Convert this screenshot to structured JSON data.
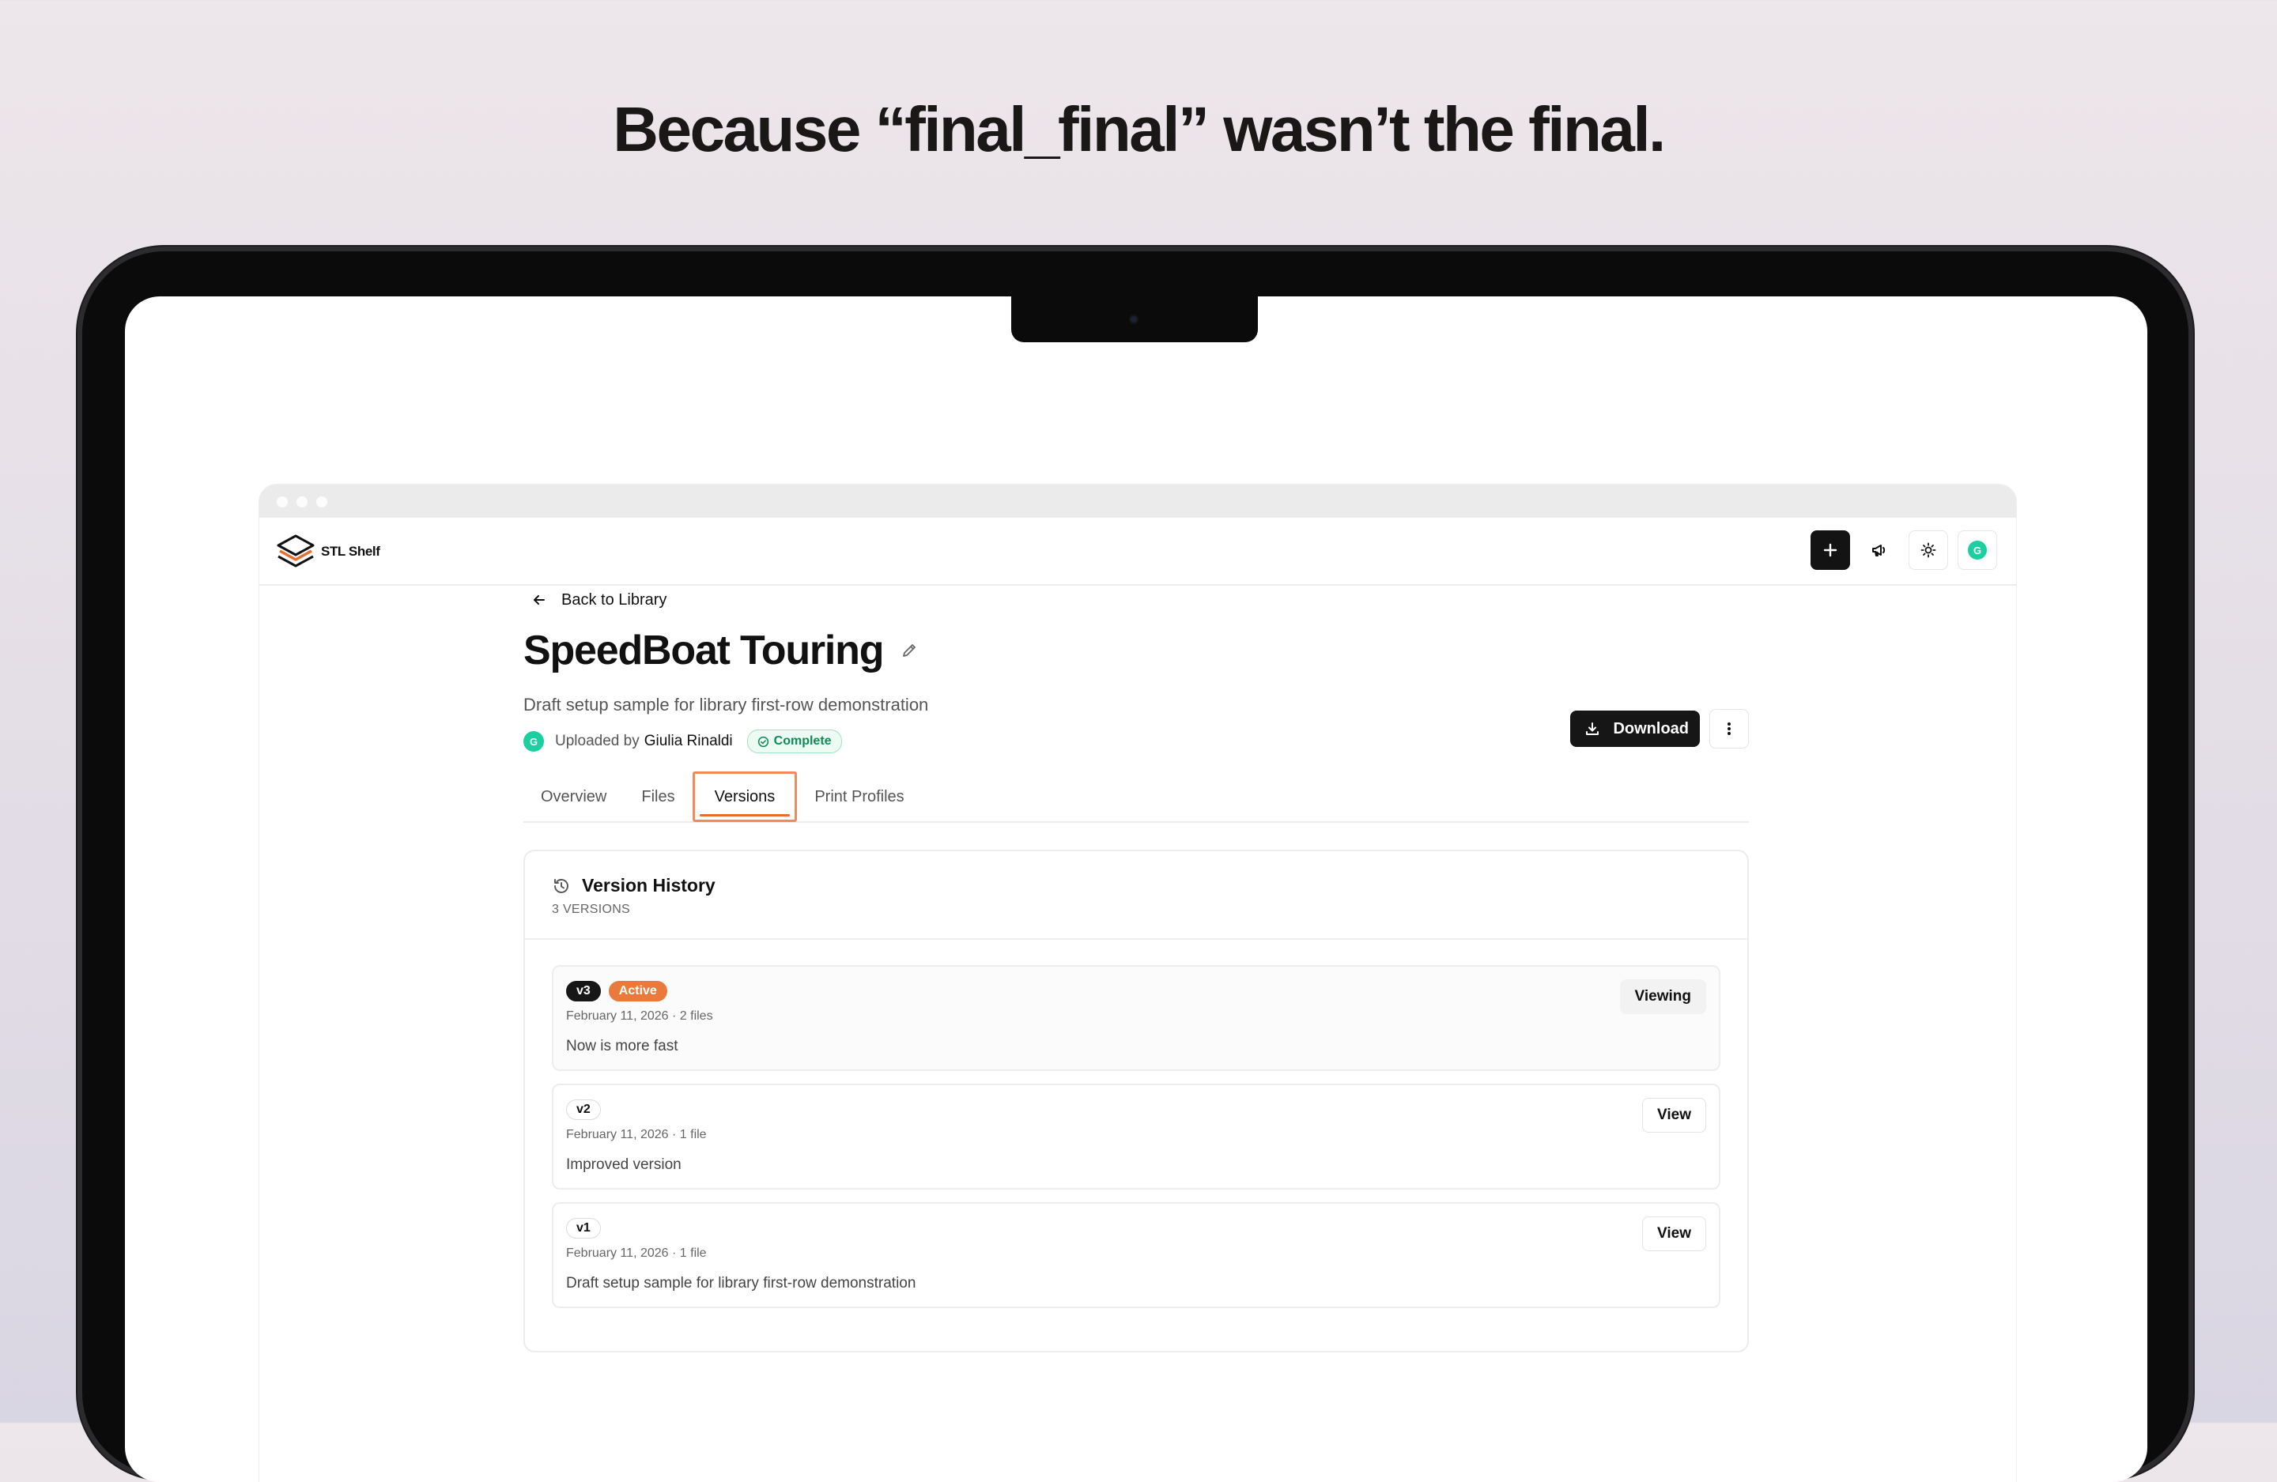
{
  "headline": "Because “final_final” wasn’t the final.",
  "app": {
    "name": "STL Shelf",
    "user_initial": "G"
  },
  "topbar": {
    "add_icon": "plus-icon",
    "announce_icon": "megaphone-icon",
    "theme_icon": "sun-icon"
  },
  "back_link": "Back to Library",
  "model": {
    "title": "SpeedBoat Touring",
    "description": "Draft setup sample for library first-row demonstration",
    "uploaded_prefix": "Uploaded by",
    "uploader": "Giulia Rinaldi",
    "uploader_initial": "G",
    "status": "Complete"
  },
  "actions": {
    "download": "Download"
  },
  "tabs": [
    {
      "label": "Overview"
    },
    {
      "label": "Files"
    },
    {
      "label": "Versions"
    },
    {
      "label": "Print Profiles"
    }
  ],
  "history": {
    "title": "Version History",
    "count": "3 VERSIONS",
    "versions": [
      {
        "tag": "v3",
        "active_label": "Active",
        "meta": "February 11, 2026 · 2 files",
        "note": "Now is more fast",
        "button": "Viewing"
      },
      {
        "tag": "v2",
        "meta": "February 11, 2026 · 1 file",
        "note": "Improved version",
        "button": "View"
      },
      {
        "tag": "v1",
        "meta": "February 11, 2026 · 1 file",
        "note": "Draft setup sample for library first-row demonstration",
        "button": "View"
      }
    ]
  },
  "colors": {
    "accent": "#ea7a3b",
    "success": "#0f8c55",
    "avatar": "#1ccfa0"
  }
}
